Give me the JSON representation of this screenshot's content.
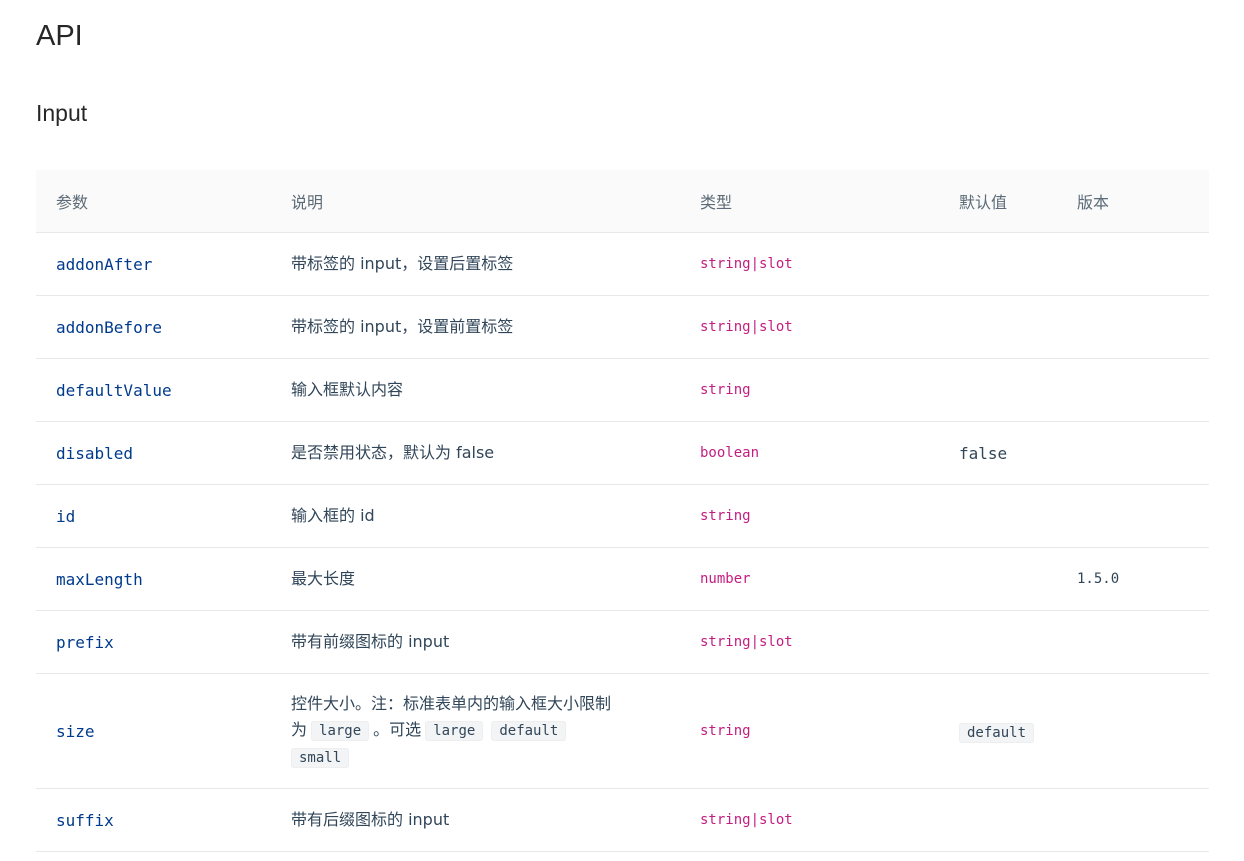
{
  "headings": {
    "api": "API",
    "component": "Input"
  },
  "table": {
    "columns": [
      "参数",
      "说明",
      "类型",
      "默认值",
      "版本"
    ],
    "rows": [
      {
        "param": "addonAfter",
        "desc": "带标签的 input，设置后置标签",
        "type": "string|slot",
        "default": "",
        "version": ""
      },
      {
        "param": "addonBefore",
        "desc": "带标签的 input，设置前置标签",
        "type": "string|slot",
        "default": "",
        "version": ""
      },
      {
        "param": "defaultValue",
        "desc": "输入框默认内容",
        "type": "string",
        "default": "",
        "version": ""
      },
      {
        "param": "disabled",
        "desc": "是否禁用状态，默认为 false",
        "type": "boolean",
        "default": "false",
        "version": ""
      },
      {
        "param": "id",
        "desc": "输入框的 id",
        "type": "string",
        "default": "",
        "version": ""
      },
      {
        "param": "maxLength",
        "desc": "最大长度",
        "type": "number",
        "default": "",
        "version": "1.5.0"
      },
      {
        "param": "prefix",
        "desc": "带有前缀图标的 input",
        "type": "string|slot",
        "default": "",
        "version": ""
      },
      {
        "param": "size",
        "desc_parts": {
          "line1": "控件大小。注：标准表单内的输入框大小限制",
          "pre": "为",
          "code1": "large",
          "mid": "。可选",
          "code2": "large",
          "code3": "default",
          "code4": "small"
        },
        "type": "string",
        "default": "default",
        "version": ""
      },
      {
        "param": "suffix",
        "desc": "带有后缀图标的 input",
        "type": "string|slot",
        "default": "",
        "version": ""
      }
    ]
  }
}
